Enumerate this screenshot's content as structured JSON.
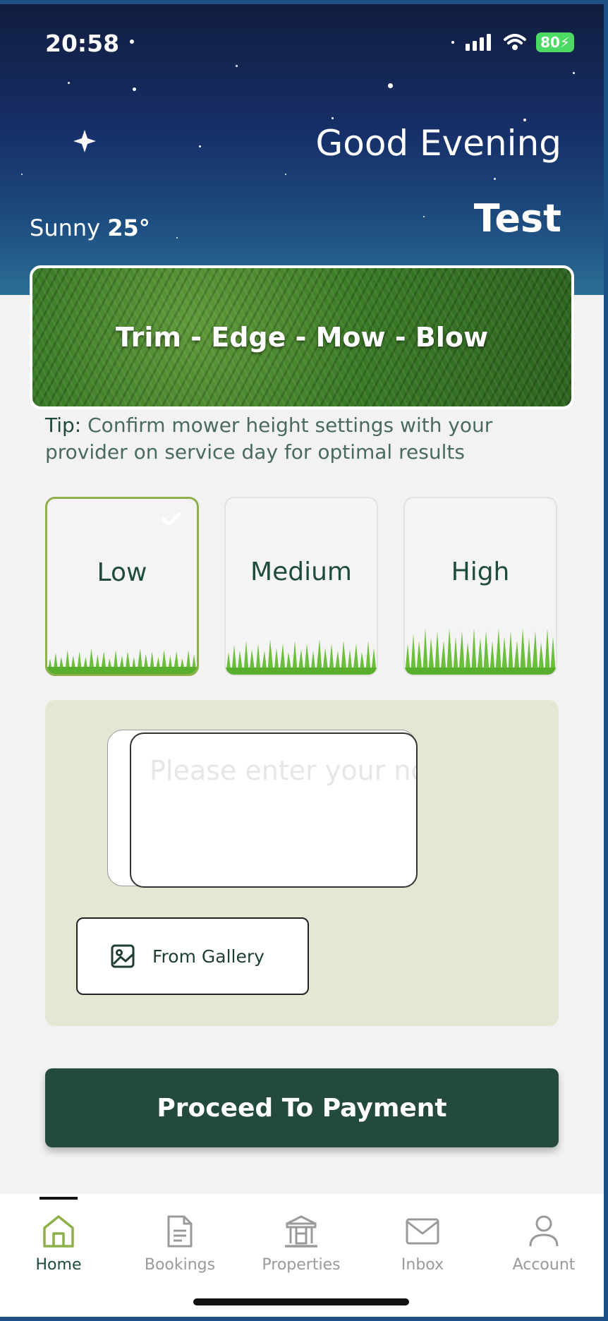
{
  "status_bar": {
    "time": "20:58",
    "battery": "80"
  },
  "header": {
    "greeting": "Good Evening",
    "username": "Test",
    "weather_condition": "Sunny",
    "temperature": "25°"
  },
  "banner": {
    "text": "Trim - Edge - Mow - Blow"
  },
  "tip": {
    "label": "Tip:",
    "text": " Confirm mower height settings with your provider on service day for optimal results"
  },
  "mower_heights": {
    "options": [
      "Low",
      "Medium",
      "High"
    ],
    "selected": "Low"
  },
  "notes": {
    "placeholder": "Please enter your notes",
    "value": ""
  },
  "gallery_button": {
    "label": "From Gallery"
  },
  "payment_button": {
    "label": "Proceed To Payment"
  },
  "tabs": [
    {
      "label": "Home",
      "icon": "home-icon",
      "active": true
    },
    {
      "label": "Bookings",
      "icon": "document-icon",
      "active": false
    },
    {
      "label": "Properties",
      "icon": "building-icon",
      "active": false
    },
    {
      "label": "Inbox",
      "icon": "mail-icon",
      "active": false
    },
    {
      "label": "Account",
      "icon": "person-icon",
      "active": false
    }
  ],
  "colors": {
    "primary": "#244a3e",
    "accent": "#8db04a",
    "tab_active": "#8db04a",
    "tab_inactive": "#9a9a9a"
  }
}
